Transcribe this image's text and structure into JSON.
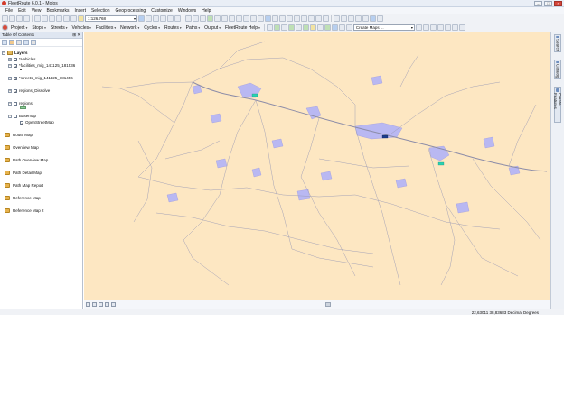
{
  "window": {
    "title": "FleetRoute 6.0.1 - Molos",
    "controls": [
      "–",
      "□",
      "×"
    ]
  },
  "menu": [
    "File",
    "Edit",
    "View",
    "Bookmarks",
    "Insert",
    "Selection",
    "Geoprocessing",
    "Customize",
    "Windows",
    "Help"
  ],
  "toolbar": {
    "scale": "1:126.768",
    "fleet_menus": [
      "Project",
      "Stops",
      "Streets",
      "Vehicles",
      "Facilities",
      "Network",
      "Cycles",
      "Routes",
      "Paths",
      "Output",
      "FleetRoute Help"
    ],
    "create_maps": "Create Maps ..."
  },
  "toc": {
    "title": "Table Of Contents",
    "pin": "⊞ ✕",
    "layers_label": "Layers",
    "layers": [
      {
        "name": "*Vehicles",
        "checked": true
      },
      {
        "name": "*facilities_mig_141125_181536",
        "checked": true
      },
      {
        "name": "*streets_mig_141125_181456",
        "checked": true
      },
      {
        "name": "regions_Dissolve",
        "checked": true
      },
      {
        "name": "regions",
        "checked": false
      },
      {
        "name": "Basemap",
        "checked": false
      },
      {
        "name": "OpenStreetMap",
        "checked": true
      }
    ],
    "check_mark": "✓",
    "maps": [
      "Route Map",
      "Overview Map",
      "Path Overview Map",
      "Path Detail Map",
      "Path Map Report",
      "Reference Map",
      "Reference Map 2"
    ]
  },
  "right_dock": [
    "Search",
    "Catalog",
    "Create Features"
  ],
  "status": {
    "coords": "22,63011  38,83683 Decimal Degrees"
  },
  "colors": {
    "map_background": "#fde7c2",
    "streets": "#8d8da8",
    "regions": "#b9b8f2",
    "facility_marker": "#2ad1b2"
  }
}
